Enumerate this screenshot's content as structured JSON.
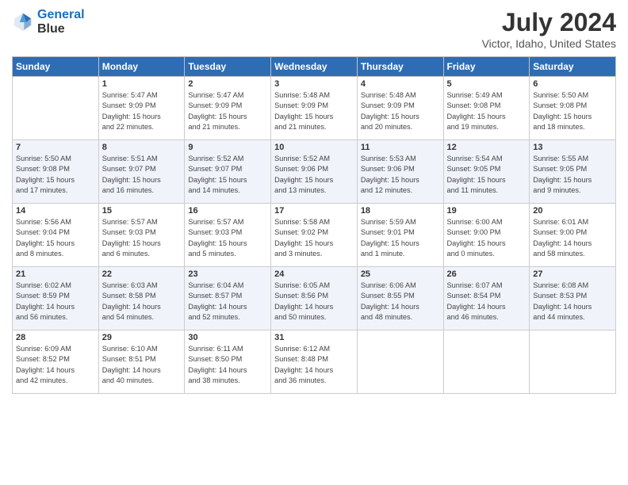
{
  "header": {
    "logo_line1": "General",
    "logo_line2": "Blue",
    "month": "July 2024",
    "location": "Victor, Idaho, United States"
  },
  "days_of_week": [
    "Sunday",
    "Monday",
    "Tuesday",
    "Wednesday",
    "Thursday",
    "Friday",
    "Saturday"
  ],
  "weeks": [
    [
      {
        "day": "",
        "info": ""
      },
      {
        "day": "1",
        "info": "Sunrise: 5:47 AM\nSunset: 9:09 PM\nDaylight: 15 hours\nand 22 minutes."
      },
      {
        "day": "2",
        "info": "Sunrise: 5:47 AM\nSunset: 9:09 PM\nDaylight: 15 hours\nand 21 minutes."
      },
      {
        "day": "3",
        "info": "Sunrise: 5:48 AM\nSunset: 9:09 PM\nDaylight: 15 hours\nand 21 minutes."
      },
      {
        "day": "4",
        "info": "Sunrise: 5:48 AM\nSunset: 9:09 PM\nDaylight: 15 hours\nand 20 minutes."
      },
      {
        "day": "5",
        "info": "Sunrise: 5:49 AM\nSunset: 9:08 PM\nDaylight: 15 hours\nand 19 minutes."
      },
      {
        "day": "6",
        "info": "Sunrise: 5:50 AM\nSunset: 9:08 PM\nDaylight: 15 hours\nand 18 minutes."
      }
    ],
    [
      {
        "day": "7",
        "info": "Sunrise: 5:50 AM\nSunset: 9:08 PM\nDaylight: 15 hours\nand 17 minutes."
      },
      {
        "day": "8",
        "info": "Sunrise: 5:51 AM\nSunset: 9:07 PM\nDaylight: 15 hours\nand 16 minutes."
      },
      {
        "day": "9",
        "info": "Sunrise: 5:52 AM\nSunset: 9:07 PM\nDaylight: 15 hours\nand 14 minutes."
      },
      {
        "day": "10",
        "info": "Sunrise: 5:52 AM\nSunset: 9:06 PM\nDaylight: 15 hours\nand 13 minutes."
      },
      {
        "day": "11",
        "info": "Sunrise: 5:53 AM\nSunset: 9:06 PM\nDaylight: 15 hours\nand 12 minutes."
      },
      {
        "day": "12",
        "info": "Sunrise: 5:54 AM\nSunset: 9:05 PM\nDaylight: 15 hours\nand 11 minutes."
      },
      {
        "day": "13",
        "info": "Sunrise: 5:55 AM\nSunset: 9:05 PM\nDaylight: 15 hours\nand 9 minutes."
      }
    ],
    [
      {
        "day": "14",
        "info": "Sunrise: 5:56 AM\nSunset: 9:04 PM\nDaylight: 15 hours\nand 8 minutes."
      },
      {
        "day": "15",
        "info": "Sunrise: 5:57 AM\nSunset: 9:03 PM\nDaylight: 15 hours\nand 6 minutes."
      },
      {
        "day": "16",
        "info": "Sunrise: 5:57 AM\nSunset: 9:03 PM\nDaylight: 15 hours\nand 5 minutes."
      },
      {
        "day": "17",
        "info": "Sunrise: 5:58 AM\nSunset: 9:02 PM\nDaylight: 15 hours\nand 3 minutes."
      },
      {
        "day": "18",
        "info": "Sunrise: 5:59 AM\nSunset: 9:01 PM\nDaylight: 15 hours\nand 1 minute."
      },
      {
        "day": "19",
        "info": "Sunrise: 6:00 AM\nSunset: 9:00 PM\nDaylight: 15 hours\nand 0 minutes."
      },
      {
        "day": "20",
        "info": "Sunrise: 6:01 AM\nSunset: 9:00 PM\nDaylight: 14 hours\nand 58 minutes."
      }
    ],
    [
      {
        "day": "21",
        "info": "Sunrise: 6:02 AM\nSunset: 8:59 PM\nDaylight: 14 hours\nand 56 minutes."
      },
      {
        "day": "22",
        "info": "Sunrise: 6:03 AM\nSunset: 8:58 PM\nDaylight: 14 hours\nand 54 minutes."
      },
      {
        "day": "23",
        "info": "Sunrise: 6:04 AM\nSunset: 8:57 PM\nDaylight: 14 hours\nand 52 minutes."
      },
      {
        "day": "24",
        "info": "Sunrise: 6:05 AM\nSunset: 8:56 PM\nDaylight: 14 hours\nand 50 minutes."
      },
      {
        "day": "25",
        "info": "Sunrise: 6:06 AM\nSunset: 8:55 PM\nDaylight: 14 hours\nand 48 minutes."
      },
      {
        "day": "26",
        "info": "Sunrise: 6:07 AM\nSunset: 8:54 PM\nDaylight: 14 hours\nand 46 minutes."
      },
      {
        "day": "27",
        "info": "Sunrise: 6:08 AM\nSunset: 8:53 PM\nDaylight: 14 hours\nand 44 minutes."
      }
    ],
    [
      {
        "day": "28",
        "info": "Sunrise: 6:09 AM\nSunset: 8:52 PM\nDaylight: 14 hours\nand 42 minutes."
      },
      {
        "day": "29",
        "info": "Sunrise: 6:10 AM\nSunset: 8:51 PM\nDaylight: 14 hours\nand 40 minutes."
      },
      {
        "day": "30",
        "info": "Sunrise: 6:11 AM\nSunset: 8:50 PM\nDaylight: 14 hours\nand 38 minutes."
      },
      {
        "day": "31",
        "info": "Sunrise: 6:12 AM\nSunset: 8:48 PM\nDaylight: 14 hours\nand 36 minutes."
      },
      {
        "day": "",
        "info": ""
      },
      {
        "day": "",
        "info": ""
      },
      {
        "day": "",
        "info": ""
      }
    ]
  ]
}
